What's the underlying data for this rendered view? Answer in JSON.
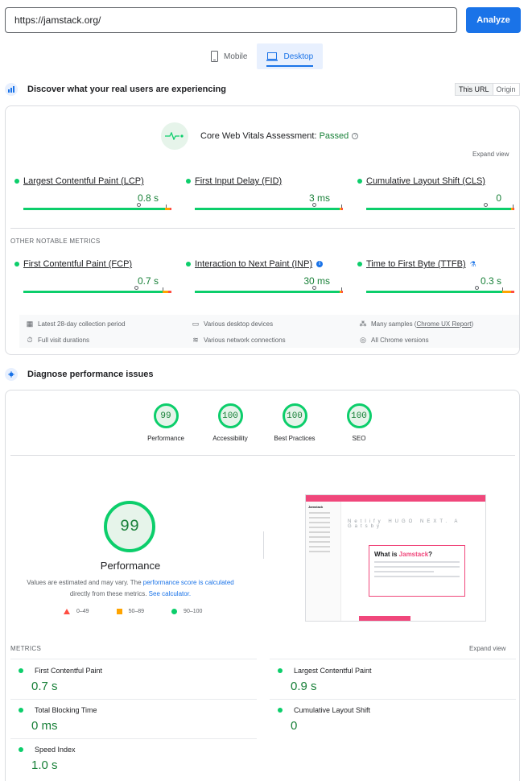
{
  "url_input": {
    "value": "https://jamstack.org/"
  },
  "analyze_label": "Analyze",
  "device_tabs": [
    {
      "label": "Mobile",
      "icon": "mobile-icon",
      "active": false
    },
    {
      "label": "Desktop",
      "icon": "desktop-icon",
      "active": true
    }
  ],
  "field": {
    "title": "Discover what your real users are experiencing",
    "toggle": [
      "This URL",
      "Origin"
    ],
    "assessment_prefix": "Core Web Vitals Assessment:",
    "assessment_result": "Passed",
    "expand_view": "Expand view",
    "core_metrics": [
      {
        "name": "Largest Contentful Paint (LCP)",
        "value": "0.8 s",
        "dist": [
          0.96,
          0.03,
          0.01
        ]
      },
      {
        "name": "First Input Delay (FID)",
        "value": "3 ms",
        "dist": [
          0.99,
          0.005,
          0.005
        ]
      },
      {
        "name": "Cumulative Layout Shift (CLS)",
        "value": "0",
        "dist": [
          0.99,
          0.005,
          0.005
        ]
      }
    ],
    "other_title": "OTHER NOTABLE METRICS",
    "other_metrics": [
      {
        "name": "First Contentful Paint (FCP)",
        "value": "0.7 s",
        "dist": [
          0.94,
          0.04,
          0.02
        ]
      },
      {
        "name": "Interaction to Next Paint (INP)",
        "value": "30 ms",
        "dist": [
          0.99,
          0.005,
          0.005
        ]
      },
      {
        "name": "Time to First Byte (TTFB)",
        "value": "0.3 s",
        "dist": [
          0.92,
          0.06,
          0.02
        ]
      }
    ],
    "info": {
      "period": "Latest 28-day collection period",
      "devices": "Various desktop devices",
      "samples_prefix": "Many samples (",
      "samples_link": "Chrome UX Report",
      "samples_suffix": ")",
      "visit": "Full visit durations",
      "network": "Various network connections",
      "chrome": "All Chrome versions"
    }
  },
  "diagnose": {
    "title": "Diagnose performance issues",
    "scores": [
      {
        "score": "99",
        "label": "Performance"
      },
      {
        "score": "100",
        "label": "Accessibility"
      },
      {
        "score": "100",
        "label": "Best Practices"
      },
      {
        "score": "100",
        "label": "SEO"
      }
    ],
    "main_score": "99",
    "main_label": "Performance",
    "note_1": "Values are estimated and may vary. The ",
    "note_link1": "performance score is calculated",
    "note_2": " directly from these metrics. ",
    "note_link2": "See calculator.",
    "legend": [
      "0–49",
      "50–89",
      "90–100"
    ],
    "screenshot": {
      "logo": "Jamstack",
      "hero_prefix": "What is ",
      "hero_accent": "Jamstack",
      "hero_suffix": "?",
      "logos": "Netlify HUGO NEXT. A Gatsby"
    },
    "metrics_title": "METRICS",
    "expand_view": "Expand view",
    "lab_metrics": [
      {
        "name": "First Contentful Paint",
        "value": "0.7 s"
      },
      {
        "name": "Largest Contentful Paint",
        "value": "0.9 s"
      },
      {
        "name": "Total Blocking Time",
        "value": "0 ms"
      },
      {
        "name": "Cumulative Layout Shift",
        "value": "0"
      },
      {
        "name": "Speed Index",
        "value": "1.0 s"
      }
    ]
  },
  "colors": {
    "accent": "#1a73e8",
    "pass": "#0cce6b",
    "pass_text": "#188038",
    "average": "#ffa400",
    "fail": "#ff4e42"
  }
}
